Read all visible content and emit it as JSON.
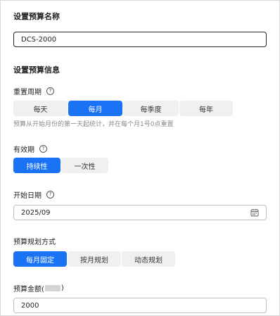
{
  "name_section": {
    "title": "设置预算名称",
    "value": "DCS-2000"
  },
  "info_section": {
    "title": "设置预算信息"
  },
  "reset_cycle": {
    "label": "重置周期",
    "options": [
      "每天",
      "每月",
      "每季度",
      "每年"
    ],
    "selected": "每月",
    "hint": "预算从开始月份的第一天起统计，并在每个月1号0点重置"
  },
  "validity": {
    "label": "有效期",
    "options": [
      "持续性",
      "一次性"
    ],
    "selected": "持续性"
  },
  "start_date": {
    "label": "开始日期",
    "value": "2025/09"
  },
  "planning": {
    "label": "预算规划方式",
    "options": [
      "每月固定",
      "按月规划",
      "动态规划"
    ],
    "selected": "每月固定"
  },
  "amount": {
    "label_prefix": "预算金额(",
    "label_suffix": ")",
    "value": "2000"
  },
  "colors": {
    "accent": "#1a73f5",
    "segment_bg": "#f0f0f0"
  }
}
